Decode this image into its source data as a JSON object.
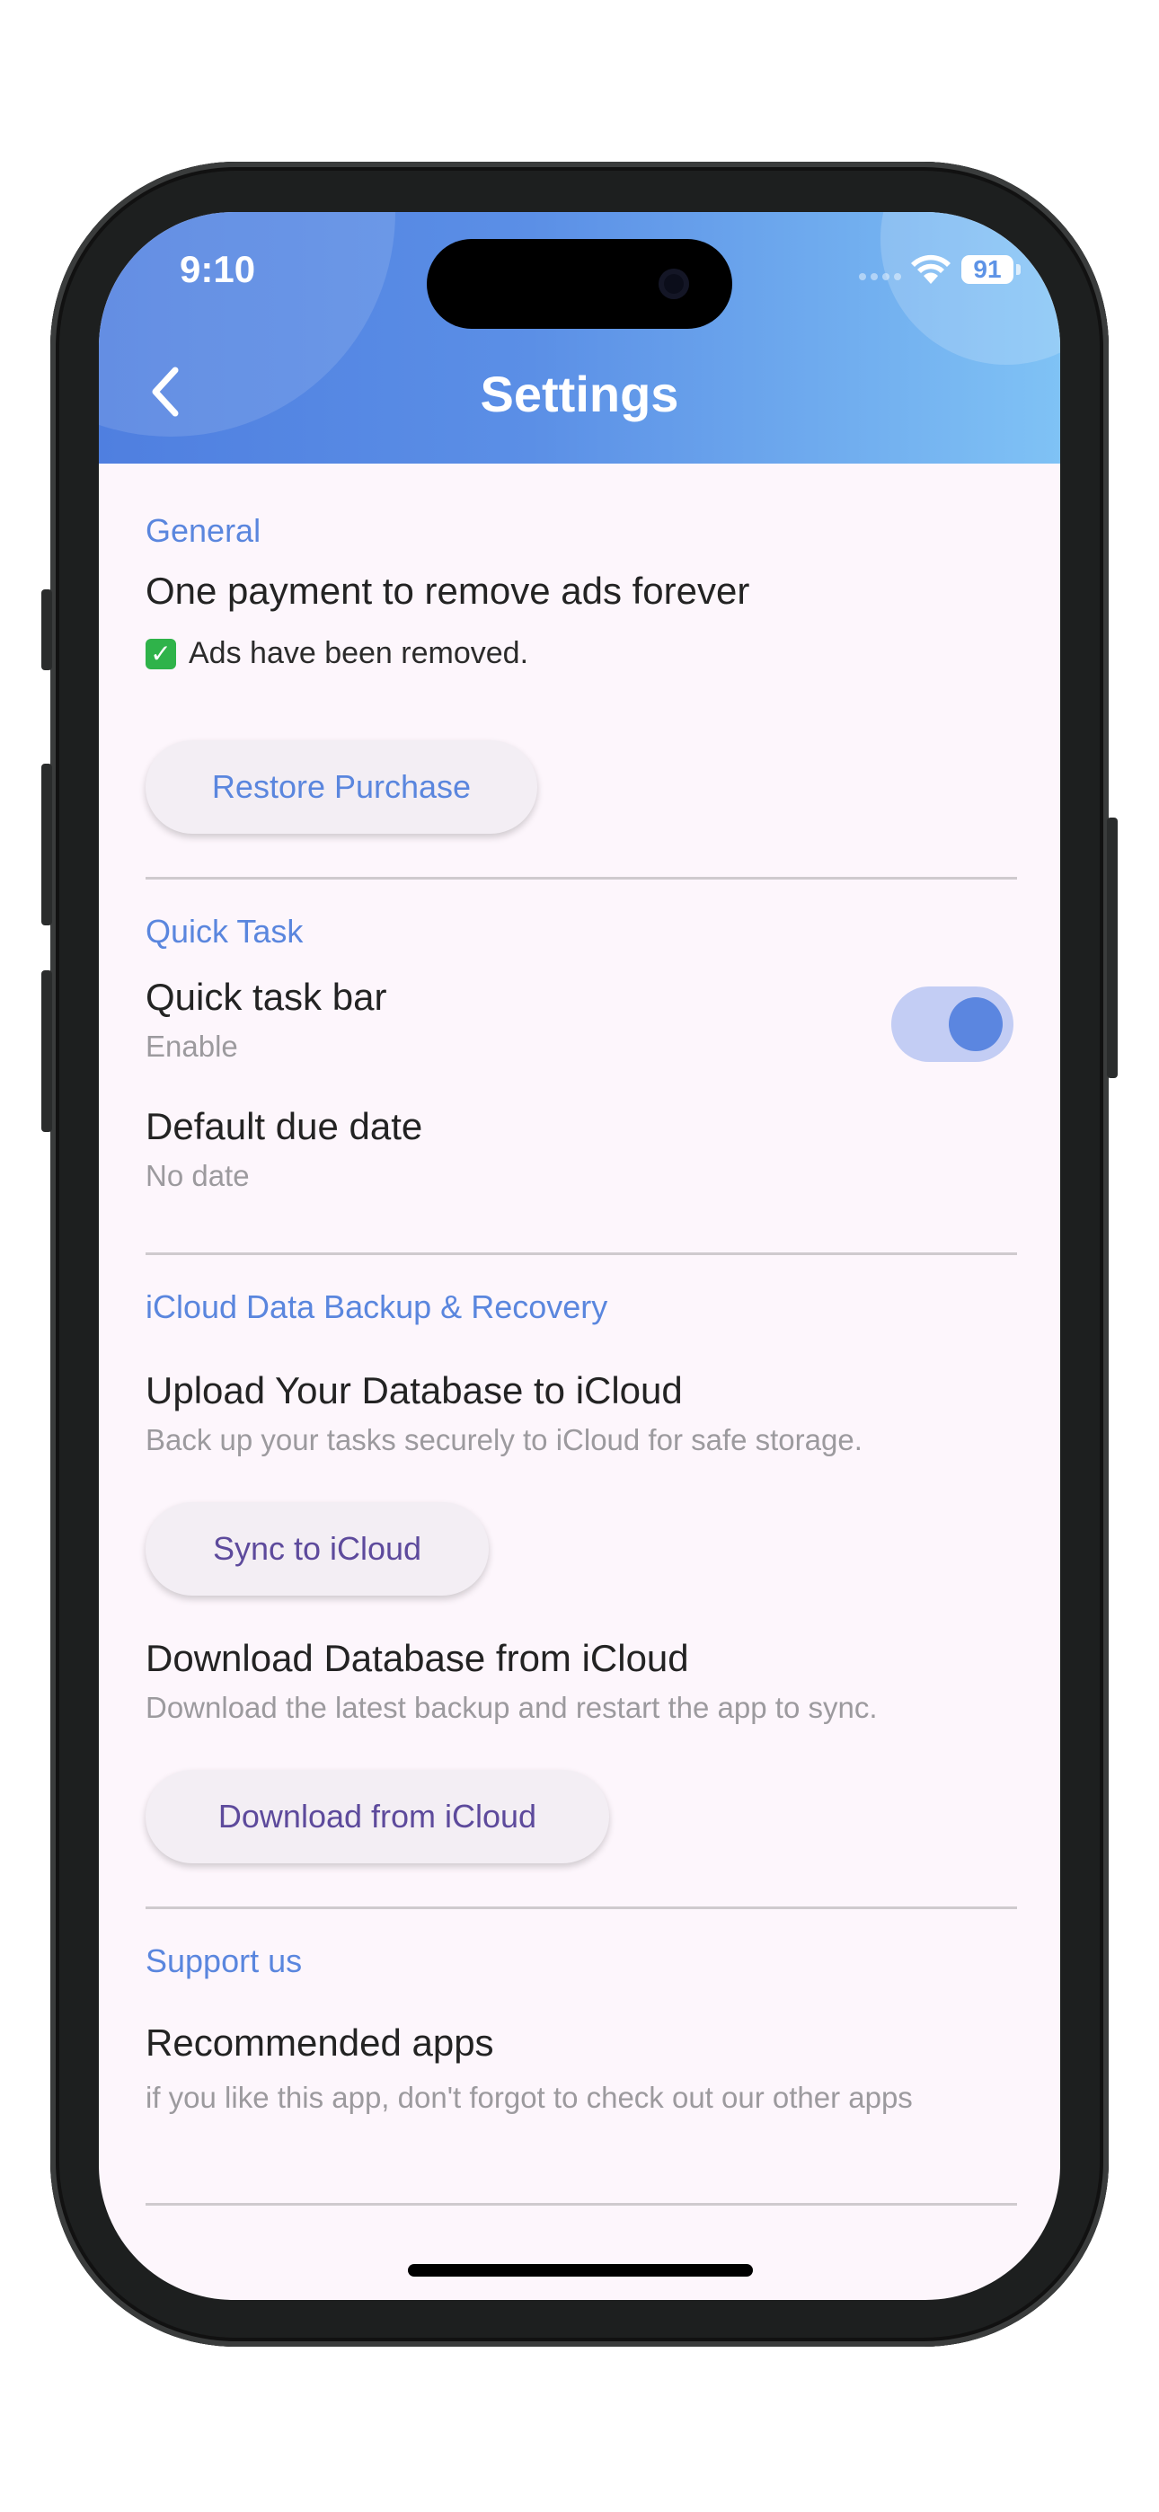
{
  "status_bar": {
    "time": "9:10",
    "battery": "91"
  },
  "header": {
    "title": "Settings"
  },
  "general": {
    "section_title": "General",
    "remove_ads_title": "One payment to remove ads forever",
    "ads_status": "Ads have been removed.",
    "restore_label": "Restore Purchase"
  },
  "quick_task": {
    "section_title": "Quick Task",
    "bar_title": "Quick task bar",
    "bar_subtitle": "Enable",
    "bar_enabled": true,
    "due_title": "Default due date",
    "due_value": "No date"
  },
  "icloud": {
    "section_title": "iCloud Data Backup & Recovery",
    "upload_title": "Upload Your Database to iCloud",
    "upload_subtitle": "Back up your tasks securely to iCloud for safe storage.",
    "sync_label": "Sync to iCloud",
    "download_title": "Download Database from iCloud",
    "download_subtitle": "Download the latest backup and restart the app to sync.",
    "download_label": "Download from iCloud"
  },
  "support": {
    "section_title": "Support us",
    "recommended_title": "Recommended apps",
    "recommended_subtitle": "if you like this app, don't forgot to check out our other apps"
  },
  "colors": {
    "accent": "#5a86de",
    "header_start": "#4f7fe0",
    "header_end": "#7fc2f5",
    "background": "#fdf6fc",
    "button_text_blue": "#5a86de",
    "button_text_purple": "#5d4a9c"
  }
}
